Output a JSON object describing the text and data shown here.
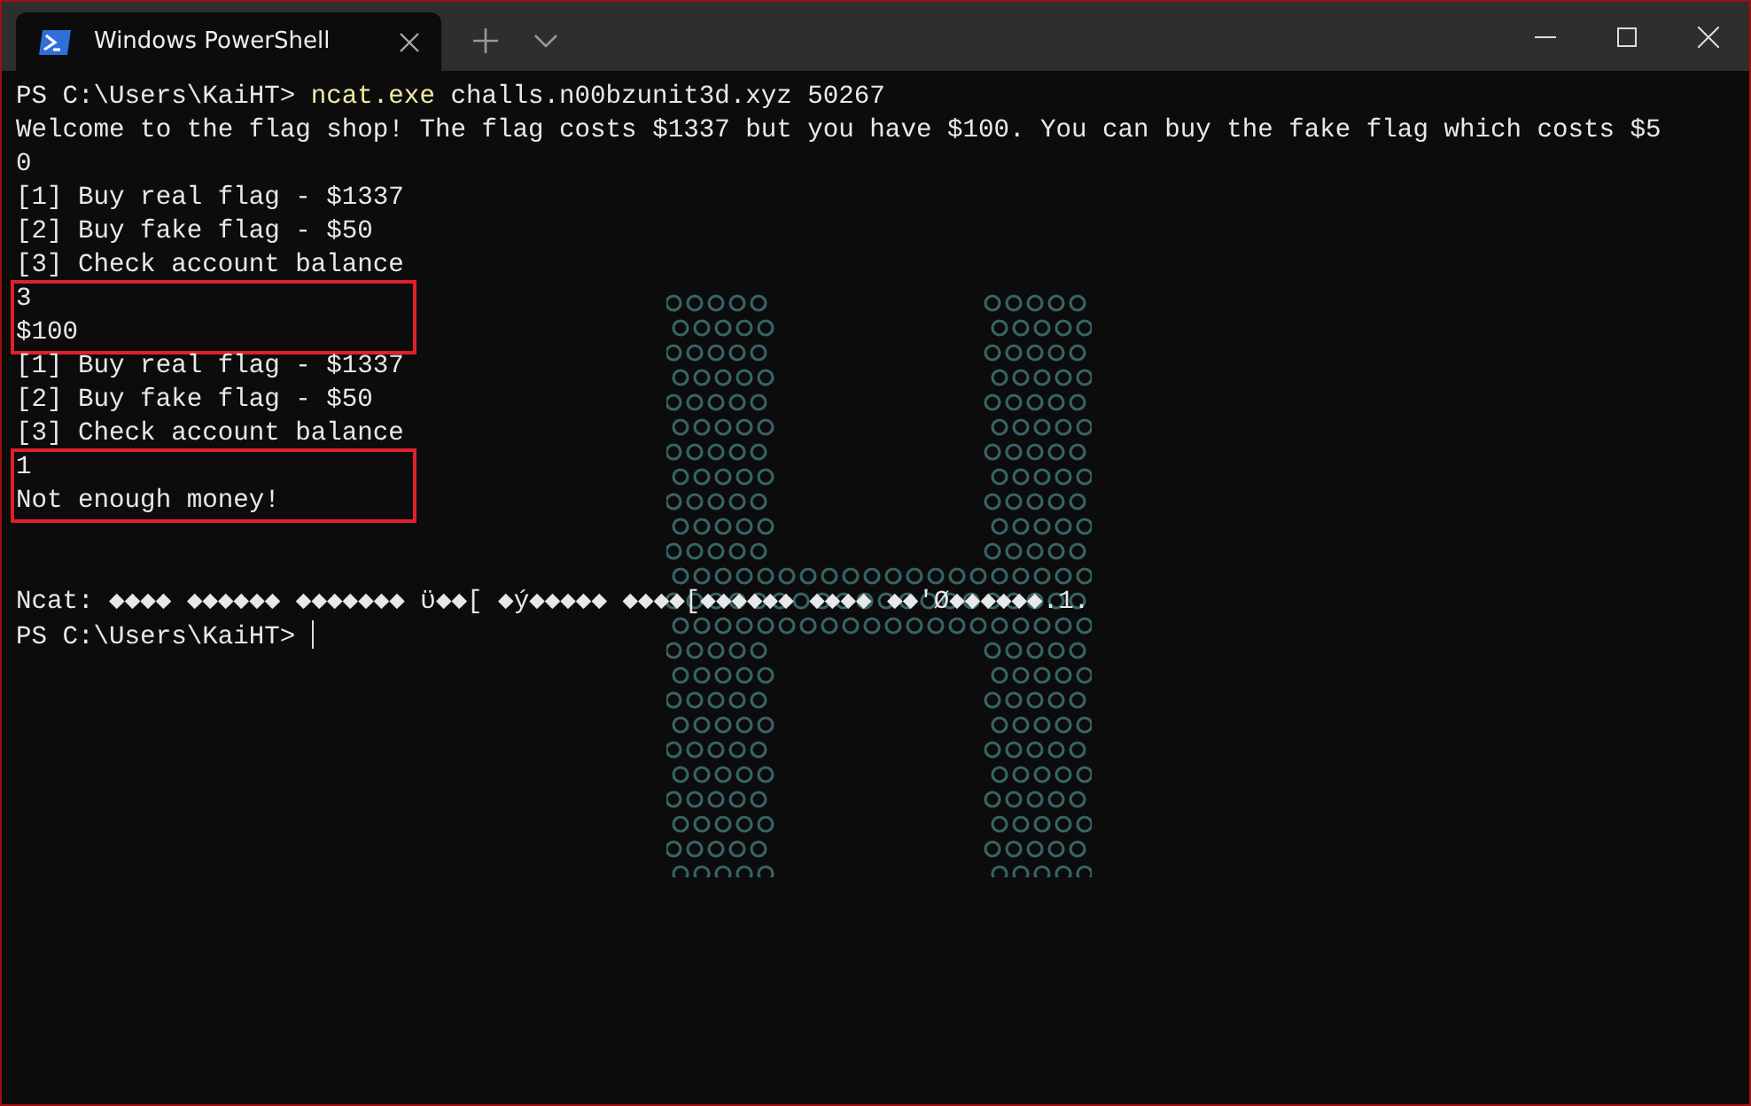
{
  "window": {
    "tab": {
      "title": "Windows PowerShell",
      "selected": true
    }
  },
  "terminal": {
    "blocks": [
      {
        "highlighted": false,
        "lines": [
          {
            "kind": "command",
            "prompt": "PS C:\\Users\\KaiHT>",
            "command": "ncat.exe",
            "args": "challs.n00bzunit3d.xyz 50267"
          },
          {
            "kind": "output",
            "text": "Welcome to the flag shop! The flag costs $1337 but you have $100. You can buy the fake flag which costs $5"
          },
          {
            "kind": "output",
            "text": "0"
          },
          {
            "kind": "output",
            "text": "[1] Buy real flag - $1337"
          },
          {
            "kind": "output",
            "text": "[2] Buy fake flag - $50"
          },
          {
            "kind": "output",
            "text": "[3] Check account balance"
          }
        ]
      },
      {
        "highlighted": true,
        "lines": [
          {
            "kind": "output",
            "text": "3"
          },
          {
            "kind": "output",
            "text": "$100"
          }
        ]
      },
      {
        "highlighted": false,
        "lines": [
          {
            "kind": "output",
            "text": "[1] Buy real flag - $1337"
          },
          {
            "kind": "output",
            "text": "[2] Buy fake flag - $50"
          },
          {
            "kind": "output",
            "text": "[3] Check account balance"
          }
        ]
      },
      {
        "highlighted": true,
        "lines": [
          {
            "kind": "output",
            "text": "1"
          },
          {
            "kind": "output",
            "text": "Not enough money!"
          }
        ]
      },
      {
        "highlighted": false,
        "lines": [
          {
            "kind": "blank"
          },
          {
            "kind": "blank"
          },
          {
            "kind": "output",
            "text": "Ncat: ◆◆◆◆ ◆◆◆◆◆◆ ◆◆◆◆◆◆◆ ϋ◆◆[ ◆ý◆◆◆◆◆ ◆◆◆◆[◆◆◆◆◆◆ ◆◆◆◆ ◆◆'Ø◆◆◆◆◆◆.1."
          },
          {
            "kind": "prompt",
            "prompt": "PS C:\\Users\\KaiHT>"
          }
        ]
      }
    ]
  }
}
